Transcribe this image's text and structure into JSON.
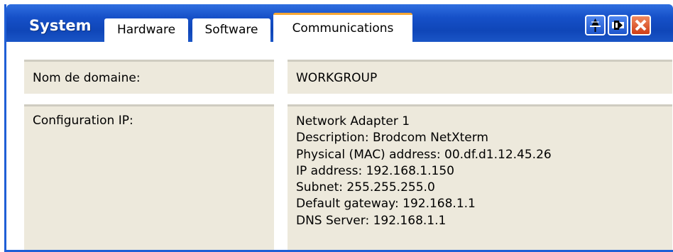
{
  "window": {
    "title": "System",
    "tabs": [
      {
        "label": "Hardware",
        "active": false
      },
      {
        "label": "Software",
        "active": false
      },
      {
        "label": "Communications",
        "active": true
      }
    ],
    "controls": [
      "pin-icon",
      "restore-icon",
      "close-icon"
    ],
    "colors": {
      "titlebar": "#1650c8",
      "active_tab_accent": "#f7a733",
      "row_bg": "#ede9dc",
      "close": "#cf3d15"
    }
  },
  "rows": [
    {
      "label": "Nom de domaine:",
      "value": "WORKGROUP"
    },
    {
      "label": "Configuration IP:",
      "lines": [
        "Network Adapter 1",
        "Description: Brodcom NetXterm",
        "Physical (MAC) address: 00.df.d1.12.45.26",
        "IP address: 192.168.1.150",
        "Subnet: 255.255.255.0",
        "Default gateway: 192.168.1.1",
        "DNS Server: 192.168.1.1"
      ]
    }
  ]
}
